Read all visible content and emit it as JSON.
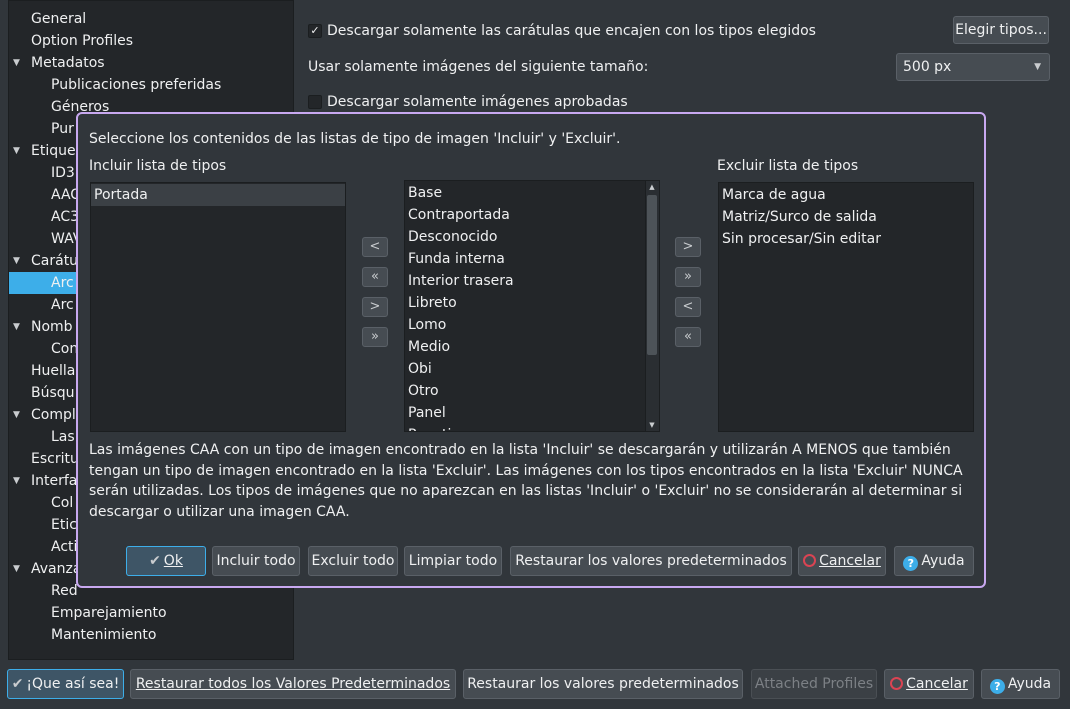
{
  "tree": {
    "items": [
      {
        "label": "General",
        "level": 0,
        "expandable": false
      },
      {
        "label": "Option Profiles",
        "level": 0,
        "expandable": false
      },
      {
        "label": "Metadatos",
        "level": 0,
        "expandable": true
      },
      {
        "label": "Publicaciones preferidas",
        "level": 1
      },
      {
        "label": "Géneros",
        "level": 1
      },
      {
        "label": "Pur",
        "level": 1
      },
      {
        "label": "Etique",
        "level": 0,
        "expandable": true
      },
      {
        "label": "ID3",
        "level": 1
      },
      {
        "label": "AAC",
        "level": 1
      },
      {
        "label": "AC3",
        "level": 1
      },
      {
        "label": "WAV",
        "level": 1
      },
      {
        "label": "Carátu",
        "level": 0,
        "expandable": true
      },
      {
        "label": "Arc",
        "level": 1,
        "selected": true
      },
      {
        "label": "Arc",
        "level": 1
      },
      {
        "label": "Nomb",
        "level": 0,
        "expandable": true
      },
      {
        "label": "Con",
        "level": 1
      },
      {
        "label": "Huella",
        "level": 0
      },
      {
        "label": "Búsqu",
        "level": 0
      },
      {
        "label": "Compl",
        "level": 0,
        "expandable": true
      },
      {
        "label": "Las",
        "level": 1
      },
      {
        "label": "Escritu",
        "level": 0
      },
      {
        "label": "Interfa",
        "level": 0,
        "expandable": true
      },
      {
        "label": "Col",
        "level": 1
      },
      {
        "label": "Etic",
        "level": 1
      },
      {
        "label": "Acti",
        "level": 1
      },
      {
        "label": "Avanza",
        "level": 0,
        "expandable": true
      },
      {
        "label": "Red",
        "level": 1
      },
      {
        "label": "Emparejamiento",
        "level": 1
      },
      {
        "label": "Mantenimiento",
        "level": 1
      }
    ]
  },
  "settings": {
    "only_matching_label": "Descargar solamente las carátulas que encajen con los tipos elegidos",
    "only_matching_checked": "✓",
    "choose_types_label": "Elegir tipos...",
    "size_label": "Usar solamente imágenes del siguiente tamaño:",
    "size_value": "500 px",
    "approved_label": "Descargar solamente imágenes aprobadas"
  },
  "dialog": {
    "instructions": "Seleccione los contenidos de las listas de tipo de imagen 'Incluir' y 'Excluir'.",
    "include_title": "Incluir lista de tipos",
    "exclude_title": "Excluir lista de tipos",
    "include_items": [
      "Portada"
    ],
    "available_items": [
      "Base",
      "Contraportada",
      "Desconocido",
      "Funda interna",
      "Interior trasera",
      "Libreto",
      "Lomo",
      "Medio",
      "Obi",
      "Otro",
      "Panel",
      "Pegatina"
    ],
    "exclude_items": [
      "Marca de agua",
      "Matriz/Surco de salida",
      "Sin procesar/Sin editar"
    ],
    "arrows_left": [
      "<",
      "«",
      ">",
      "»"
    ],
    "arrows_right": [
      ">",
      "»",
      "<",
      "«"
    ],
    "description": "Las imágenes CAA con un tipo de imagen encontrado en la lista 'Incluir' se descargarán y utilizarán A MENOS que también tengan un tipo de imagen encontrado en la lista 'Excluir'. Las imágenes con los tipos encontrados en la lista 'Excluir' NUNCA serán utilizadas. Los tipos de imágenes que no aparezcan en las listas 'Incluir' o 'Excluir' no se considerarán al determinar si descargar o utilizar una imagen CAA.",
    "buttons": {
      "ok": "Ok",
      "include_all": "Incluir todo",
      "exclude_all": "Excluir todo",
      "clear_all": "Limpiar todo",
      "restore_defaults": "Restaurar los valores predeterminados",
      "cancel": "Cancelar",
      "help": "Ayuda"
    }
  },
  "footer": {
    "ok": "¡Que así sea!",
    "restore_all": "Restaurar todos los Valores Predeterminados",
    "restore_defaults": "Restaurar los valores predeterminados",
    "attached_profiles": "Attached Profiles",
    "cancel": "Cancelar",
    "help": "Ayuda"
  }
}
